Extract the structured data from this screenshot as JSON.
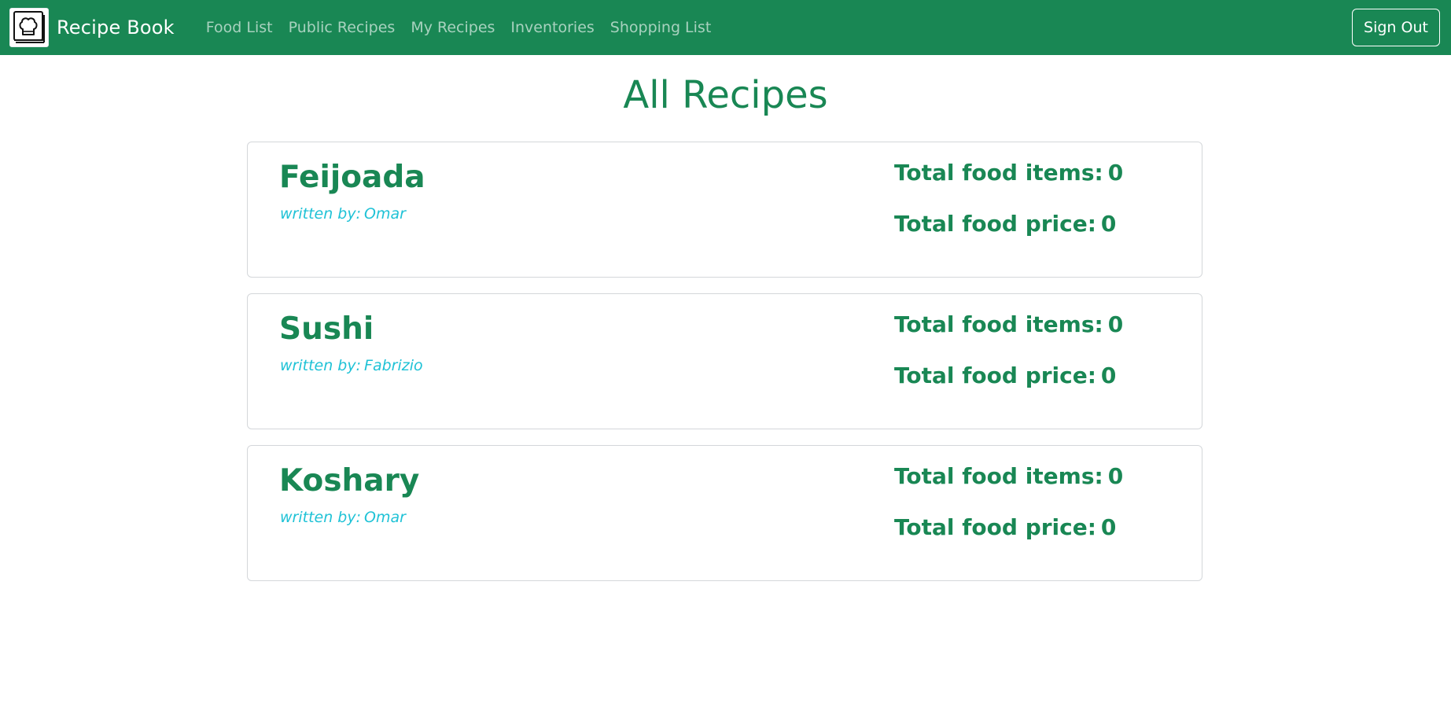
{
  "navbar": {
    "brand": "Recipe Book",
    "links": [
      "Food List",
      "Public Recipes",
      "My Recipes",
      "Inventories",
      "Shopping List"
    ],
    "sign_out": "Sign Out",
    "bg_color": "#198754",
    "logo_icon": "chef-book-icon"
  },
  "page": {
    "title": "All Recipes",
    "accent_color": "#198754",
    "author_color": "#1fc2d6"
  },
  "labels": {
    "written_by": "written by:",
    "total_items": "Total food items:",
    "total_price": "Total food price:"
  },
  "recipes": [
    {
      "name": "Feijoada",
      "author": "Omar",
      "total_items": "0",
      "total_price": "0"
    },
    {
      "name": "Sushi",
      "author": "Fabrizio",
      "total_items": "0",
      "total_price": "0"
    },
    {
      "name": "Koshary",
      "author": "Omar",
      "total_items": "0",
      "total_price": "0"
    }
  ]
}
